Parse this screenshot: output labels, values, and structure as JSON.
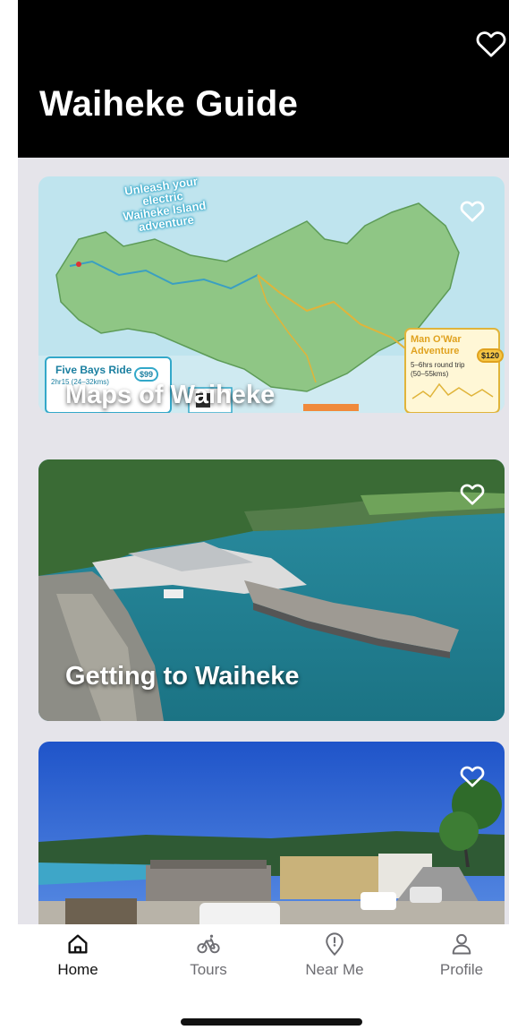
{
  "header": {
    "title": "Waiheke Guide",
    "favorite_icon": "heart-outline-icon"
  },
  "cards": [
    {
      "title": "Maps of Waiheke",
      "favorite_icon": "heart-outline-icon",
      "map": {
        "heading": "Unleash your\nelectric\nWaiheke Island\nadventure",
        "left_route": {
          "name": "Five Bays Ride",
          "duration": "2hr15 (24–32kms)",
          "price": "$99"
        },
        "right_route": {
          "name": "Man O'War Adventure",
          "duration": "5–6hrs round trip",
          "distance": "(50–55kms)",
          "price": "$120"
        }
      }
    },
    {
      "title": "Getting to Waiheke",
      "favorite_icon": "heart-outline-icon"
    },
    {
      "title": "",
      "favorite_icon": "heart-outline-icon"
    }
  ],
  "tabs": [
    {
      "label": "Home",
      "icon": "home-icon",
      "active": true
    },
    {
      "label": "Tours",
      "icon": "bicycle-icon",
      "active": false
    },
    {
      "label": "Near Me",
      "icon": "location-pin-icon",
      "active": false
    },
    {
      "label": "Profile",
      "icon": "user-icon",
      "active": false
    }
  ],
  "colors": {
    "header_bg": "#000000",
    "feed_bg": "#e5e4ea",
    "title_text": "#ffffff",
    "tab_active": "#111111",
    "tab_inactive": "#6d6d72"
  }
}
